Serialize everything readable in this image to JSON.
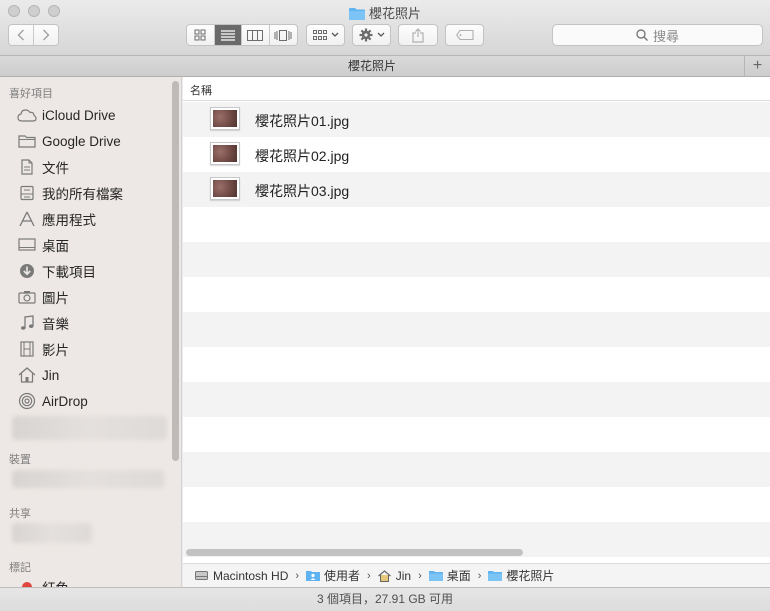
{
  "window": {
    "title": "櫻花照片"
  },
  "search": {
    "placeholder": "搜尋"
  },
  "tabbar": {
    "tab_label": "櫻花照片",
    "add_label": "+"
  },
  "sidebar": {
    "favorites_title": "喜好項目",
    "favorites": [
      {
        "label": "iCloud Drive",
        "icon": "cloud-icon"
      },
      {
        "label": "Google Drive",
        "icon": "folder-icon"
      },
      {
        "label": "文件",
        "icon": "document-icon"
      },
      {
        "label": "我的所有檔案",
        "icon": "all-files-icon"
      },
      {
        "label": "應用程式",
        "icon": "applications-icon"
      },
      {
        "label": "桌面",
        "icon": "desktop-icon"
      },
      {
        "label": "下載項目",
        "icon": "download-icon"
      },
      {
        "label": "圖片",
        "icon": "camera-icon"
      },
      {
        "label": "音樂",
        "icon": "music-icon"
      },
      {
        "label": "影片",
        "icon": "film-icon"
      },
      {
        "label": "Jin",
        "icon": "home-icon"
      },
      {
        "label": "AirDrop",
        "icon": "airdrop-icon"
      }
    ],
    "devices_title": "裝置",
    "shared_title": "共享",
    "tags_title": "標記",
    "tags": [
      {
        "label": "紅色",
        "color": "#e0443e"
      }
    ]
  },
  "list": {
    "column_name": "名稱",
    "files": [
      {
        "name": "櫻花照片01.jpg"
      },
      {
        "name": "櫻花照片02.jpg"
      },
      {
        "name": "櫻花照片03.jpg"
      }
    ]
  },
  "pathbar": {
    "crumbs": [
      {
        "label": "Macintosh HD",
        "icon": "hard-drive-icon"
      },
      {
        "label": "使用者",
        "icon": "users-folder-icon"
      },
      {
        "label": "Jin",
        "icon": "home-icon"
      },
      {
        "label": "桌面",
        "icon": "folder-icon"
      },
      {
        "label": "櫻花照片",
        "icon": "folder-icon"
      }
    ]
  },
  "status": {
    "text": "3 個項目，27.91 GB 可用"
  },
  "colors": {
    "folder_blue": "#5fb3f0",
    "tag_red": "#e0443e",
    "active_segment": "#6a6a6a"
  }
}
